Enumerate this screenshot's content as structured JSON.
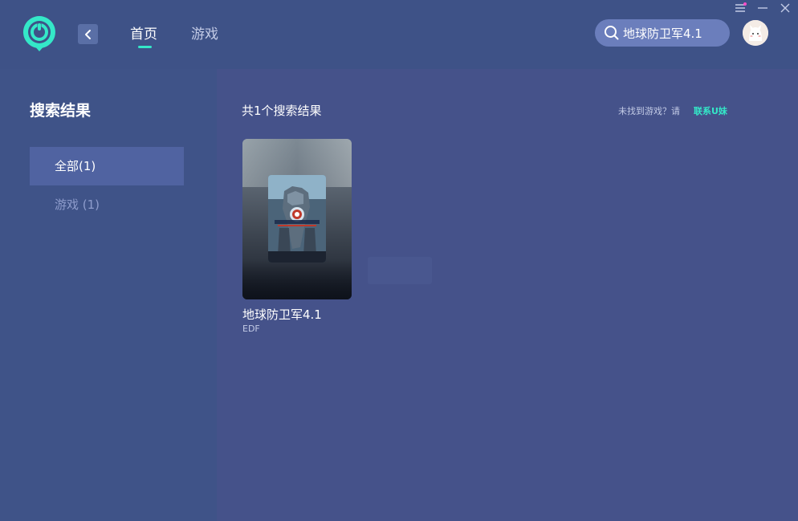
{
  "header": {
    "nav_home": "首页",
    "nav_games": "游戏",
    "search_value": "地球防卫军4.1"
  },
  "sidebar": {
    "title": "搜索结果",
    "items": [
      {
        "label": "全部(1)",
        "active": true
      },
      {
        "label": "游戏 (1)",
        "active": false
      }
    ]
  },
  "main": {
    "result_count": "共1个搜索结果",
    "not_found_text": "未找到游戏？请",
    "contact_link": "联系U妹",
    "results": [
      {
        "title": "地球防卫军4.1",
        "subtitle": "EDF"
      }
    ]
  },
  "colors": {
    "accent": "#34e8c8",
    "background": "#45528a",
    "sidebar_bg": "#3f5388",
    "topbar_bg": "#3e5287",
    "active_item_bg": "#5063a1",
    "search_bg": "#6b7ebc"
  },
  "icons": [
    "app-logo-icon",
    "chevron-left-icon",
    "search-icon",
    "avatar",
    "menu-icon",
    "minimize-icon",
    "close-icon"
  ]
}
